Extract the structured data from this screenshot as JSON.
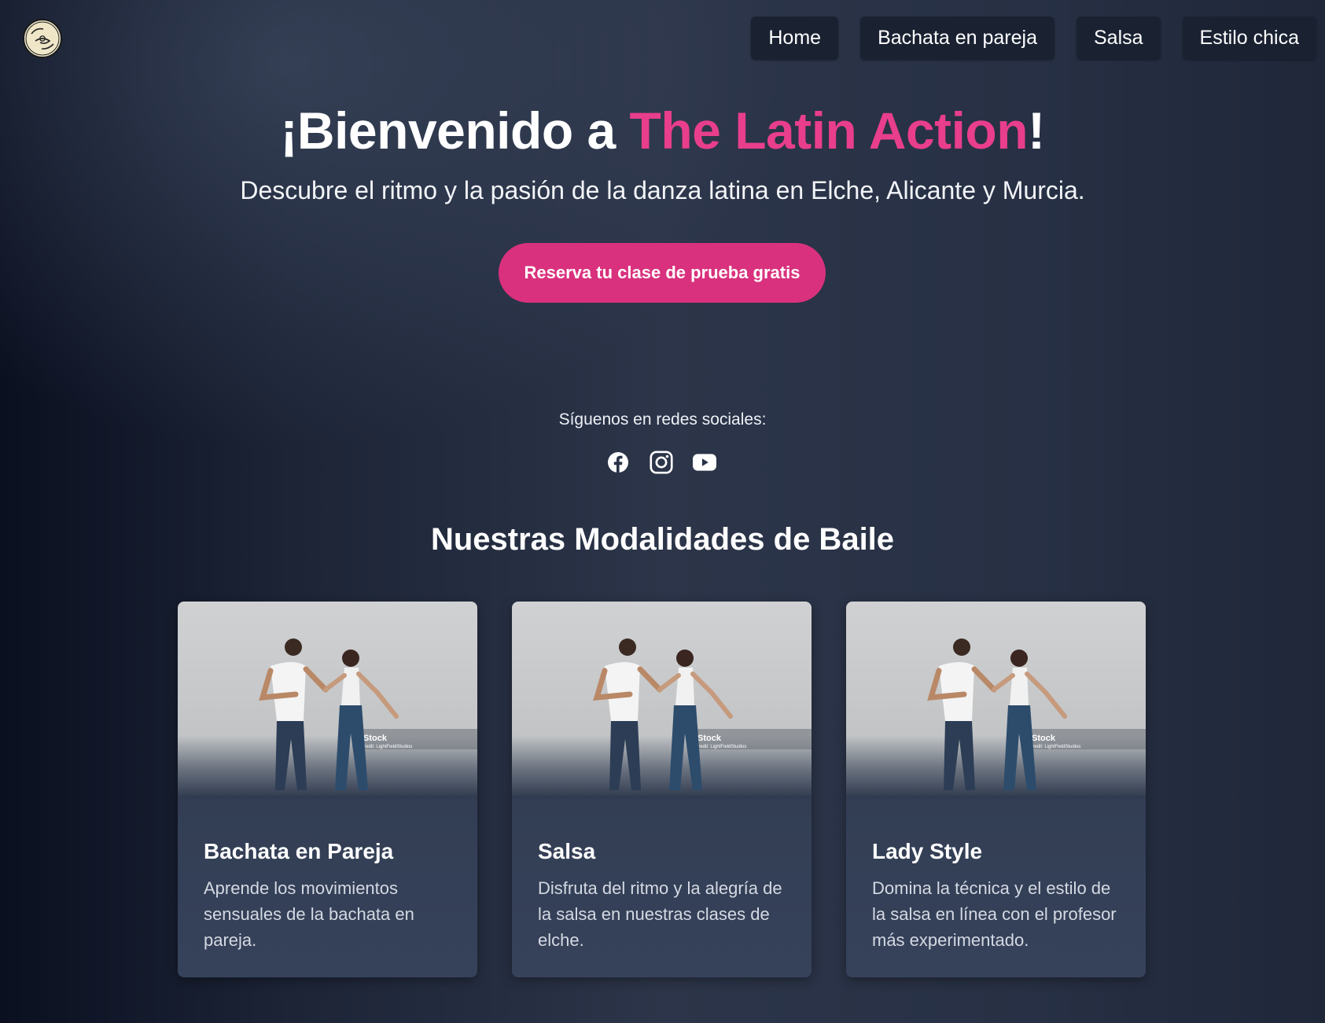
{
  "header": {
    "logo_text": "The Latin Action",
    "nav": [
      {
        "label": "Home"
      },
      {
        "label": "Bachata en pareja"
      },
      {
        "label": "Salsa"
      },
      {
        "label": "Estilo chica"
      }
    ]
  },
  "hero": {
    "title_prefix": "¡Bienvenido a ",
    "title_brand": "The Latin Action",
    "title_suffix": "!",
    "subtitle": "Descubre el ritmo y la pasión de la danza latina en Elche, Alicante y Murcia.",
    "cta_label": "Reserva tu clase de prueba gratis"
  },
  "social": {
    "label": "Síguenos en redes sociales:",
    "icons": [
      "facebook-icon",
      "instagram-icon",
      "youtube-icon"
    ]
  },
  "modalities": {
    "title": "Nuestras Modalidades de Baile",
    "cards": [
      {
        "title": "Bachata en Pareja",
        "description": "Aprende los movimientos sensuales de la bachata en pareja.",
        "watermark": "iStock",
        "credit": "Credit: LightFieldStudios"
      },
      {
        "title": "Salsa",
        "description": "Disfruta del ritmo y la alegría de la salsa en nuestras clases de elche.",
        "watermark": "iStock",
        "credit": "Credit: LightFieldStudios"
      },
      {
        "title": "Lady Style",
        "description": "Domina la técnica y el estilo de la salsa en línea con el profesor más experimentado.",
        "watermark": "iStock",
        "credit": "Credit: LightFieldStudios"
      }
    ]
  },
  "colors": {
    "accent": "#e83e8c",
    "cta": "#d9317d",
    "nav_bg": "#1a2232",
    "card_bg": "#333e54"
  }
}
